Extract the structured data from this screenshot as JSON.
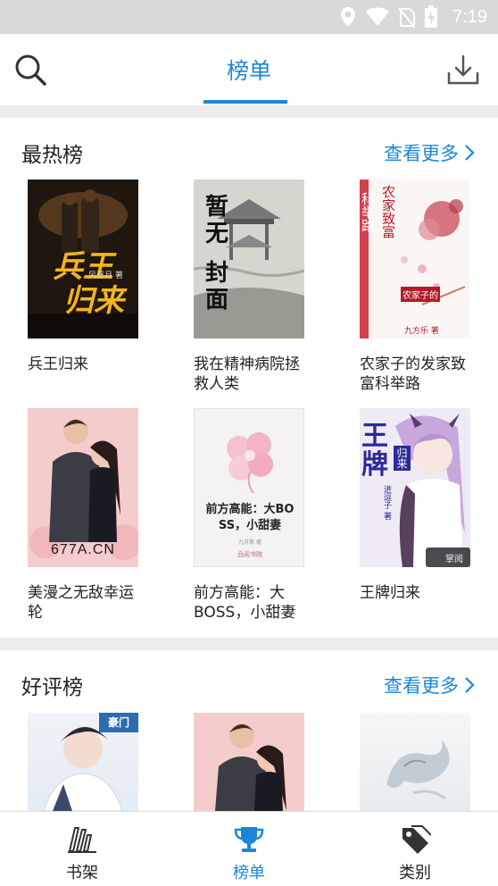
{
  "status_bar": {
    "time": "7:19"
  },
  "app_bar": {
    "title": "榜单"
  },
  "sections": [
    {
      "title": "最热榜",
      "more_label": "查看更多",
      "books": [
        {
          "title": "兵王归来",
          "cover_text": [
            "兵王",
            "归来",
            "风逐月 著"
          ]
        },
        {
          "title": "我在精神病院拯救人类",
          "cover_text": [
            "暂",
            "无",
            "封",
            "面"
          ]
        },
        {
          "title": "农家子的发家致富科举路",
          "cover_text": [
            "农家致富",
            "科举路",
            "农家子的",
            "九方乐 著"
          ]
        },
        {
          "title": "美漫之无敌幸运轮",
          "cover_text": [
            "677A.CN"
          ]
        },
        {
          "title": "前方高能：大BOSS，小甜妻",
          "cover_text": [
            "前方高能：大BO",
            "SS，小甜妻",
            "九月紫 著",
            "品阅书院"
          ]
        },
        {
          "title": "王牌归来",
          "cover_text": [
            "王牌",
            "归来",
            "进逗子 著",
            "掌阅"
          ]
        }
      ]
    },
    {
      "title": "好评榜",
      "more_label": "查看更多",
      "books": [
        {
          "title": "",
          "cover_text": [
            "豪门"
          ]
        },
        {
          "title": "",
          "cover_text": []
        },
        {
          "title": "",
          "cover_text": []
        }
      ]
    }
  ],
  "tabs": [
    {
      "label": "书架",
      "icon": "bookshelf-icon",
      "active": false
    },
    {
      "label": "榜单",
      "icon": "trophy-icon",
      "active": true
    },
    {
      "label": "类别",
      "icon": "tag-icon",
      "active": false
    }
  ],
  "colors": {
    "accent": "#1b86d8",
    "status_bar": "#d9d9d9",
    "divider": "#ececec"
  }
}
